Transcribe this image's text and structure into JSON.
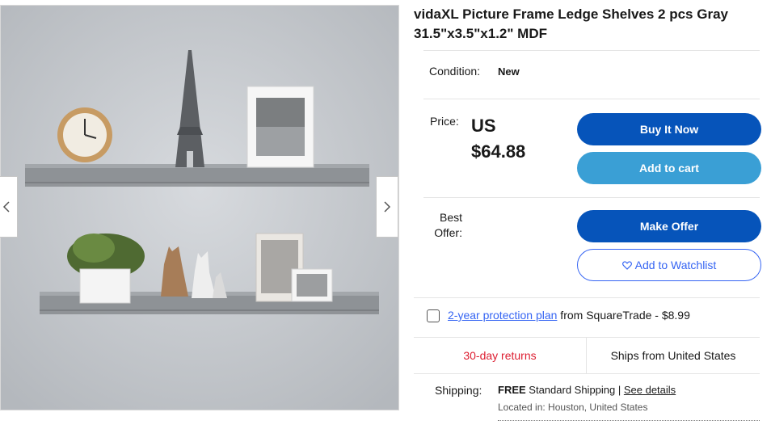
{
  "product": {
    "title": "vidaXL Picture Frame Ledge Shelves 2 pcs Gray 31.5\"x3.5\"x1.2\" MDF"
  },
  "gallery": {
    "prev_icon": "chevron-left-icon",
    "next_icon": "chevron-right-icon"
  },
  "condition": {
    "label": "Condition:",
    "value": "New"
  },
  "price": {
    "label": "Price:",
    "currency": "US",
    "amount": "$64.88"
  },
  "actions": {
    "buy_now": "Buy It Now",
    "add_to_cart": "Add to cart",
    "make_offer": "Make Offer",
    "watchlist": "Add to Watchlist",
    "watchlist_icon": "heart-outline-icon"
  },
  "best_offer": {
    "label_line1": "Best",
    "label_line2": "Offer:"
  },
  "protection": {
    "link": "2-year protection plan",
    "text": " from SquareTrade - $8.99"
  },
  "returns": {
    "left": "30-day returns",
    "right": "Ships from United States"
  },
  "shipping": {
    "label": "Shipping:",
    "free": "FREE",
    "method": " Standard Shipping | ",
    "details_link": "See details",
    "located_label": "Located in:",
    "located_value": " Houston, United States"
  },
  "colors": {
    "primary_button": "#0654ba",
    "secondary_button": "#3a9fd5",
    "link": "#3665f3",
    "returns_red": "#dd1e31"
  }
}
